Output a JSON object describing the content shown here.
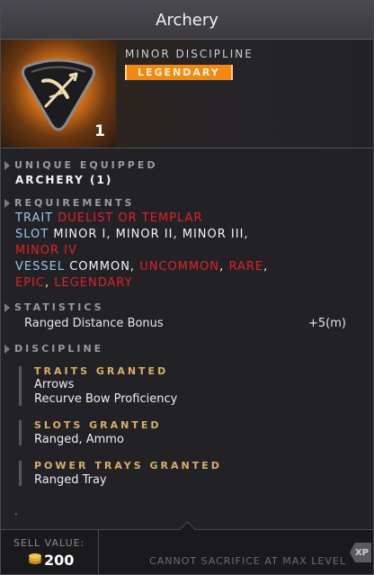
{
  "title": "Archery",
  "header": {
    "discipline_type": "MINOR DISCIPLINE",
    "rarity": "LEGENDARY",
    "count": "1",
    "icon": "archery-bow-icon"
  },
  "unique_equipped": {
    "heading": "UNIQUE EQUIPPED",
    "value": "ARCHERY (1)"
  },
  "requirements": {
    "heading": "REQUIREMENTS",
    "trait_label": "TRAIT",
    "trait_value": "DUELIST OR TEMPLAR",
    "slot_label": "SLOT",
    "slot_value_1": "MINOR I, MINOR II, MINOR III,",
    "slot_value_2": "MINOR IV",
    "vessel_label": "VESSEL",
    "vessel_common": "COMMON",
    "vessel_uncommon": "UNCOMMON",
    "vessel_rare": "RARE",
    "vessel_epic": "EPIC",
    "vessel_legendary": "LEGENDARY",
    "comma": ","
  },
  "statistics": {
    "heading": "STATISTICS",
    "stat_name": "Ranged Distance Bonus",
    "stat_value": "+5(m)"
  },
  "discipline": {
    "heading": "DISCIPLINE",
    "traits_title": "TRAITS GRANTED",
    "traits": [
      "Arrows",
      "Recurve Bow Proficiency"
    ],
    "slots_title": "SLOTS GRANTED",
    "slots": "Ranged, Ammo",
    "trays_title": "POWER TRAYS GRANTED",
    "trays": "Ranged Tray"
  },
  "dot": ".",
  "footer": {
    "sell_label": "SELL VALUE:",
    "sell_value": "200",
    "sacrifice_text": "CANNOT SACRIFICE AT MAX LEVEL",
    "xp_badge": "XP"
  },
  "colors": {
    "rarity_orange": "#f28a12",
    "requirement_red": "#e0202a",
    "label_blue": "#9fc3e8",
    "discipline_gold": "#d9b06a"
  }
}
